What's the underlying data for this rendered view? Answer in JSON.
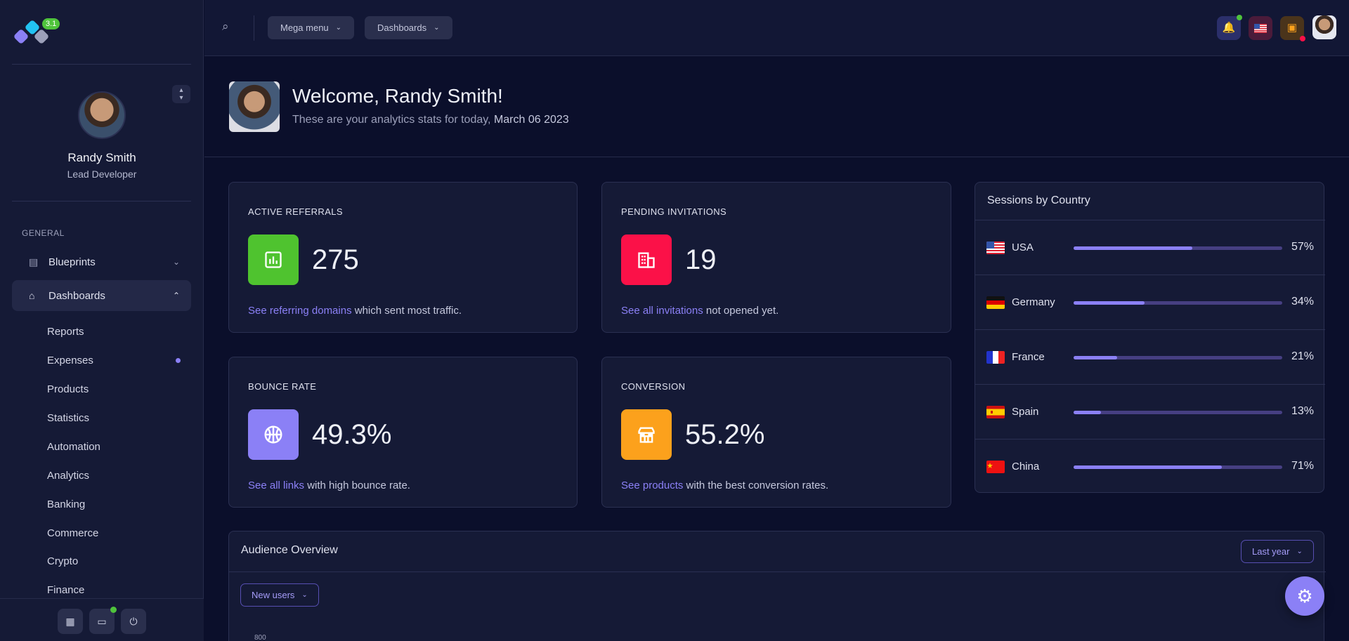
{
  "brand": {
    "version_badge": "3.1"
  },
  "sidebar": {
    "profile": {
      "name": "Randy Smith",
      "role": "Lead Developer"
    },
    "section_label": "GENERAL",
    "groups": [
      {
        "label": "Blueprints",
        "icon": "blueprint-icon",
        "expanded": false
      },
      {
        "label": "Dashboards",
        "icon": "dashboard-icon",
        "expanded": true
      }
    ],
    "dashboard_items": [
      "Reports",
      "Expenses",
      "Products",
      "Statistics",
      "Automation",
      "Analytics",
      "Banking",
      "Commerce",
      "Crypto",
      "Finance"
    ],
    "active_item_dot_color": "#8b80f6",
    "bottom_buttons": [
      "calendar-icon",
      "chat-icon",
      "power-icon"
    ]
  },
  "topbar": {
    "menus": [
      {
        "label": "Mega menu"
      },
      {
        "label": "Dashboards"
      }
    ],
    "icons": [
      "notification-icon",
      "language-flag-icon",
      "messages-icon",
      "user-avatar"
    ]
  },
  "welcome": {
    "title": "Welcome, Randy Smith!",
    "subtitle": "These are your analytics stats for today,",
    "date": "March 06 2023"
  },
  "stats": [
    {
      "label": "ACTIVE REFERRALS",
      "value": "275",
      "link": "See referring domains",
      "rest": " which sent most traffic.",
      "color": "#4fc32f",
      "icon": "chart-icon"
    },
    {
      "label": "PENDING INVITATIONS",
      "value": "19",
      "link": "See all invitations",
      "rest": " not opened yet.",
      "color": "#fb1148",
      "icon": "building-icon"
    },
    {
      "label": "BOUNCE RATE",
      "value": "49.3%",
      "link": "See all links",
      "rest": " with high bounce rate.",
      "color": "#8b80f6",
      "icon": "basketball-icon"
    },
    {
      "label": "CONVERSION",
      "value": "55.2%",
      "link": "See products",
      "rest": " with the best conversion rates.",
      "color": "#fca11c",
      "icon": "store-icon"
    }
  ],
  "sessions": {
    "title": "Sessions by Country",
    "rows": [
      {
        "country": "USA",
        "percent": "57%",
        "value": 57,
        "flag": "us-flag-icon"
      },
      {
        "country": "Germany",
        "percent": "34%",
        "value": 34,
        "flag": "de-flag-icon"
      },
      {
        "country": "France",
        "percent": "21%",
        "value": 21,
        "flag": "fr-flag-icon"
      },
      {
        "country": "Spain",
        "percent": "13%",
        "value": 13,
        "flag": "es-flag-icon"
      },
      {
        "country": "China",
        "percent": "71%",
        "value": 71,
        "flag": "cn-flag-icon"
      }
    ]
  },
  "audience": {
    "title": "Audience Overview",
    "period": "Last year",
    "metric": "New users",
    "first_tick": "800"
  },
  "colors": {
    "accent": "#8b80f6",
    "background": "#0b0f2b",
    "panel": "#151a36"
  }
}
